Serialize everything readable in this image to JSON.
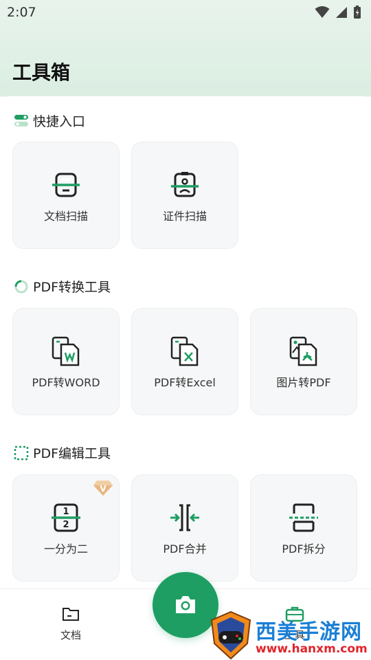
{
  "status_bar": {
    "time": "2:07"
  },
  "page_title": "工具箱",
  "sections": [
    {
      "title": "快捷入口",
      "tools": [
        {
          "label": "文档扫描",
          "icon": "document-scan-icon"
        },
        {
          "label": "证件扫描",
          "icon": "id-scan-icon"
        }
      ]
    },
    {
      "title": "PDF转换工具",
      "tools": [
        {
          "label": "PDF转WORD",
          "icon": "pdf-to-word-icon"
        },
        {
          "label": "PDF转Excel",
          "icon": "pdf-to-excel-icon"
        },
        {
          "label": "图片转PDF",
          "icon": "image-to-pdf-icon"
        }
      ]
    },
    {
      "title": "PDF编辑工具",
      "tools": [
        {
          "label": "一分为二",
          "icon": "split-in-two-icon",
          "vip": true
        },
        {
          "label": "PDF合并",
          "icon": "pdf-merge-icon"
        },
        {
          "label": "PDF拆分",
          "icon": "pdf-split-icon"
        }
      ]
    }
  ],
  "vip_badge_letter": "V",
  "split_icon_numbers": [
    "1",
    "2"
  ],
  "bottom_nav": {
    "left_label": "文档",
    "right_label": "工具"
  },
  "watermark": {
    "title": "西美手游网",
    "url": "www.hanxm.com"
  },
  "colors": {
    "accent": "#1e9e63",
    "tile_bg": "#f6f7f8",
    "vip": "#d9a066"
  }
}
